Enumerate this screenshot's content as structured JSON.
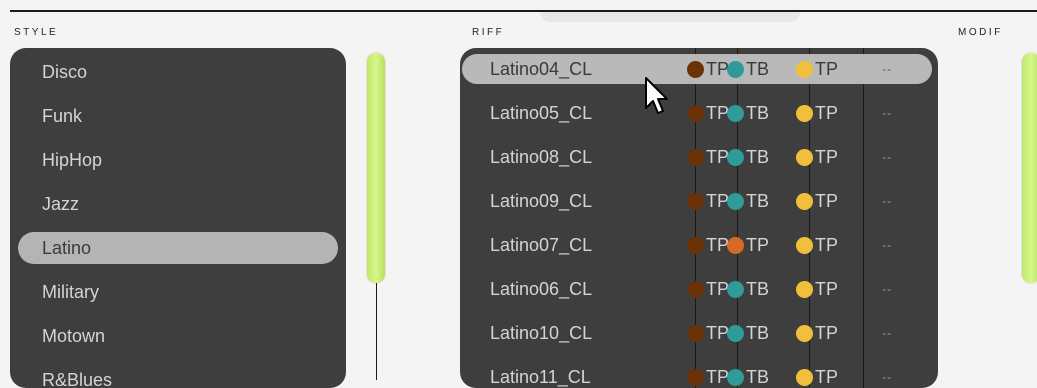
{
  "sections": {
    "style_label": "STYLE",
    "riff_label": "RIFF",
    "modif_label": "MODIF"
  },
  "styles": [
    "Disco",
    "Funk",
    "HipHop",
    "Jazz",
    "Latino",
    "Military",
    "Motown",
    "R&Blues"
  ],
  "selected_style": "Latino",
  "channel_colors": {
    "dark_brown": "#6b3208",
    "teal": "#2e9a9a",
    "yellow": "#f2bf3c",
    "orange": "#d76a22"
  },
  "riffs": [
    {
      "name": "Latino04_CL",
      "selected": true,
      "channels": [
        {
          "color": "#6b3208",
          "label": "TP"
        },
        {
          "color": "#2e9a9a",
          "label": "TB"
        },
        {
          "color": "#f2bf3c",
          "label": "TP"
        }
      ],
      "modif": "--"
    },
    {
      "name": "Latino05_CL",
      "selected": false,
      "channels": [
        {
          "color": "#6b3208",
          "label": "TP"
        },
        {
          "color": "#2e9a9a",
          "label": "TB"
        },
        {
          "color": "#f2bf3c",
          "label": "TP"
        }
      ],
      "modif": "--"
    },
    {
      "name": "Latino08_CL",
      "selected": false,
      "channels": [
        {
          "color": "#6b3208",
          "label": "TP"
        },
        {
          "color": "#2e9a9a",
          "label": "TB"
        },
        {
          "color": "#f2bf3c",
          "label": "TP"
        }
      ],
      "modif": "--"
    },
    {
      "name": "Latino09_CL",
      "selected": false,
      "channels": [
        {
          "color": "#6b3208",
          "label": "TP"
        },
        {
          "color": "#2e9a9a",
          "label": "TB"
        },
        {
          "color": "#f2bf3c",
          "label": "TP"
        }
      ],
      "modif": "--"
    },
    {
      "name": "Latino07_CL",
      "selected": false,
      "channels": [
        {
          "color": "#6b3208",
          "label": "TP"
        },
        {
          "color": "#d76a22",
          "label": "TP"
        },
        {
          "color": "#f2bf3c",
          "label": "TP"
        }
      ],
      "modif": "--"
    },
    {
      "name": "Latino06_CL",
      "selected": false,
      "channels": [
        {
          "color": "#6b3208",
          "label": "TP"
        },
        {
          "color": "#2e9a9a",
          "label": "TB"
        },
        {
          "color": "#f2bf3c",
          "label": "TP"
        }
      ],
      "modif": "--"
    },
    {
      "name": "Latino10_CL",
      "selected": false,
      "channels": [
        {
          "color": "#6b3208",
          "label": "TP"
        },
        {
          "color": "#2e9a9a",
          "label": "TB"
        },
        {
          "color": "#f2bf3c",
          "label": "TP"
        }
      ],
      "modif": "--"
    },
    {
      "name": "Latino11_CL",
      "selected": false,
      "channels": [
        {
          "color": "#6b3208",
          "label": "TP"
        },
        {
          "color": "#2e9a9a",
          "label": "TB"
        },
        {
          "color": "#f2bf3c",
          "label": "TP"
        }
      ],
      "modif": "--"
    }
  ],
  "scrollbar_color": "#c8ef78",
  "cursor_icon": "arrow-pointer-icon"
}
